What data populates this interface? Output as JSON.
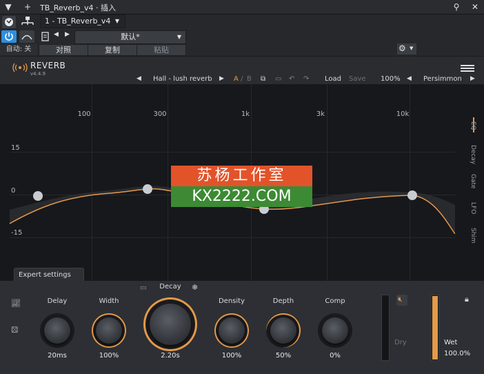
{
  "host": {
    "title": "TB_Reverb_v4 · 插入",
    "instance": "1 - TB_Reverb_v4",
    "preset": "默认*",
    "auto_label": "自动: 关",
    "compare": "对照",
    "copy": "复制",
    "paste": "粘贴"
  },
  "plugin": {
    "brand": "REVERB",
    "version": "v4.4.9",
    "preset_name": "Hall - lush reverb",
    "a": "A",
    "slash": "/",
    "b": "B",
    "load": "Load",
    "save": "Save",
    "zoom": "100%",
    "skin": "Persimmon"
  },
  "eq": {
    "freq_labels": [
      "100",
      "300",
      "1k",
      "3k",
      "10k"
    ],
    "db_labels": [
      "15",
      "0",
      "-15"
    ],
    "side_tabs": [
      "EQ",
      "Decay",
      "Gate",
      "LFO",
      "Shim"
    ],
    "expert": "Expert settings"
  },
  "knobs": {
    "delay": {
      "label": "Delay",
      "value": "20ms"
    },
    "width": {
      "label": "Width",
      "value": "100%"
    },
    "decay": {
      "label": "Decay",
      "value": "2.20s"
    },
    "density": {
      "label": "Density",
      "value": "100%"
    },
    "depth": {
      "label": "Depth",
      "value": "50%"
    },
    "comp": {
      "label": "Comp",
      "value": "0%"
    }
  },
  "mix": {
    "dry": "Dry",
    "wet": "Wet",
    "wet_value": "100.0%"
  },
  "watermark": {
    "line1": "苏杨工作室",
    "line2": "KX2222.COM"
  },
  "colors": {
    "accent": "#e39a4a",
    "host_blue": "#2f8fe0"
  }
}
